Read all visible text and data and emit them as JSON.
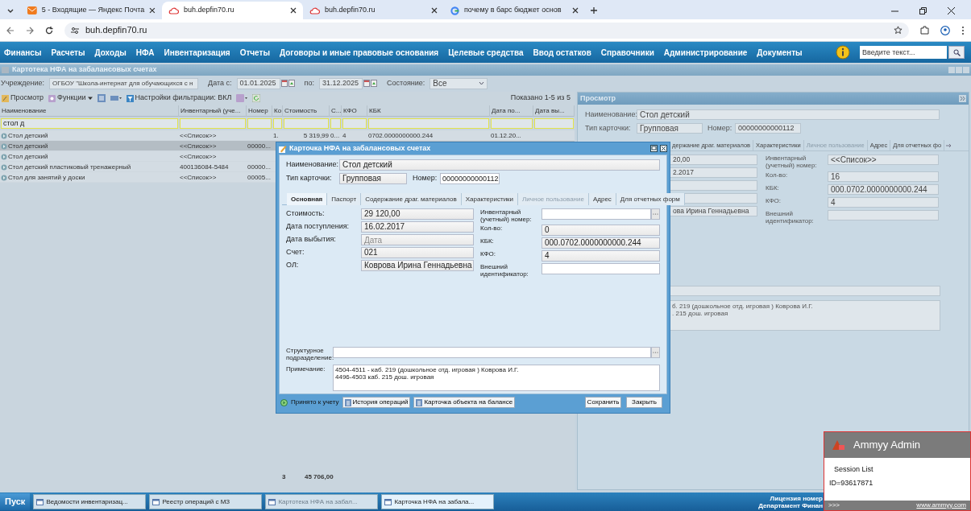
{
  "browser": {
    "tabs": [
      {
        "title": "5 - Входящие — Яндекс Почта",
        "kind": "mail",
        "selected": false
      },
      {
        "title": "buh.depfin70.ru",
        "kind": "cloud",
        "selected": true
      },
      {
        "title": "buh.depfin70.ru",
        "kind": "cloud",
        "selected": false
      },
      {
        "title": "почему в барс бюджет основ",
        "kind": "google",
        "selected": false
      }
    ],
    "url": "buh.depfin70.ru"
  },
  "menu": {
    "items": [
      "Финансы",
      "Расчеты",
      "Доходы",
      "НФА",
      "Инвентаризация",
      "Отчеты",
      "Договоры и иные правовые основания",
      "Целевые средства",
      "Ввод остатков",
      "Справочники",
      "Администрирование",
      "Документы"
    ],
    "search": {
      "placeholder": "Введите текст..."
    }
  },
  "section_title": "Картотека НФА на забалансовых счетах",
  "filters": [
    {
      "label": "Учреждение:",
      "value": "ОГБОУ \"Школа-интернат для обучающихся с н",
      "kind": "text"
    },
    {
      "label": "Дата с:",
      "value": "01.01.2025",
      "kind": "date"
    },
    {
      "label": "по:",
      "value": "31.12.2025",
      "kind": "date"
    },
    {
      "label": "Состояние:",
      "value": "Все",
      "kind": "select"
    }
  ],
  "grid": {
    "toolbar": {
      "view": "Просмотр",
      "functions": "Функции",
      "filter_settings": "Настройки фильтрации: ВКЛ",
      "shown": "Показано 1-5 из 5"
    },
    "columns": [
      "Наименование",
      "Инвентарный (уче...",
      "Номер",
      "Ко",
      "Стоимость",
      "С...",
      "КФО",
      "КБК",
      "Дата по...",
      "Дата вы..."
    ],
    "filter_value": "стол д",
    "rows": [
      {
        "cells": [
          "Стол детский",
          "<<Список>>",
          "",
          "1.",
          "5 319,99",
          "0...",
          "4",
          "0702.0000000000.244",
          "01.12.20..."
        ],
        "selected": false
      },
      {
        "cells": [
          "Стол детский",
          "<<Список>>",
          "00000..."
        ],
        "selected": true
      },
      {
        "cells": [
          "Стол детский",
          "<<Список>>"
        ],
        "selected": false
      },
      {
        "cells": [
          "Стол детский пластиковый тренажерный",
          "400136084-5484",
          "00000..."
        ],
        "selected": false
      },
      {
        "cells": [
          "Стол для занятий у доски",
          "<<Список>>",
          "00005..."
        ],
        "selected": false
      }
    ],
    "footer": {
      "count": "3",
      "total": "45 706,00"
    }
  },
  "view_panel": {
    "title": "Просмотр",
    "name_label": "Наименование:",
    "name_value": "Стол детский",
    "type_label": "Тип карточки:",
    "type_value": "Групповая",
    "number_label": "Номер:",
    "number_value": "00000000000112",
    "tabs": [
      {
        "label": "держание драг. материалов",
        "disabled": false
      },
      {
        "label": "Характеристики",
        "disabled": false
      },
      {
        "label": "Личное пользование",
        "disabled": true
      },
      {
        "label": "Адрес",
        "disabled": false
      },
      {
        "label": "Для отчетных фо",
        "disabled": false
      }
    ],
    "left_fields": [
      {
        "kind": "value",
        "value": "20,00"
      },
      {
        "kind": "value",
        "value": "2.2017"
      },
      {
        "kind": "empty"
      },
      {
        "kind": "empty"
      },
      {
        "kind": "value",
        "value": "ова Ирина Геннадьевна"
      }
    ],
    "right_fields": [
      {
        "label": "Инвентарный (учетный) номер:",
        "value": "<<Список>>"
      },
      {
        "label": "Кол-во:",
        "value": "16"
      },
      {
        "label": "КБК:",
        "value": "000.0702.0000000000.244"
      },
      {
        "label": "КФО:",
        "value": "4"
      },
      {
        "label": "Внешний идентификатор:"
      }
    ],
    "note_lines": [
      "б. 219 (дошкольное отд. игровая ) Коврова И.Г.",
      ". 215 дош. игровая"
    ]
  },
  "dialog": {
    "title": "Карточка НФА на забалансовых счетах",
    "name_label": "Наименование:",
    "name_value": "Стол детский",
    "type_label": "Тип карточки:",
    "type_value": "Групповая",
    "number_label": "Номер:",
    "number_value": "00000000000112",
    "tabs": [
      {
        "label": "Основная",
        "selected": true,
        "disabled": false
      },
      {
        "label": "Паспорт",
        "selected": false,
        "disabled": false
      },
      {
        "label": "Содержание драг. материалов",
        "selected": false,
        "disabled": false
      },
      {
        "label": "Характеристики",
        "selected": false,
        "disabled": false
      },
      {
        "label": "Личное пользование",
        "selected": false,
        "disabled": true
      },
      {
        "label": "Адрес",
        "selected": false,
        "disabled": false
      },
      {
        "label": "Для отчетных форм",
        "selected": false,
        "disabled": false
      }
    ],
    "left_fields": [
      {
        "label": "Стоимость:",
        "value": "29 120,00",
        "disabled": false
      },
      {
        "label": "Дата поступления:",
        "value": "16.02.2017",
        "disabled": false
      },
      {
        "label": "Дата выбытия:",
        "placeholder": "Дата",
        "disabled": true
      },
      {
        "label": "Счет:",
        "value": "021",
        "disabled": false
      },
      {
        "label": "ОЛ:",
        "value": "Коврова Ирина Геннадьевна",
        "disabled": false
      }
    ],
    "right_fields": [
      {
        "label": "Инвентарный (учетный) номер:",
        "picker": true
      },
      {
        "label": "Кол-во:",
        "value": "0",
        "picker": false
      },
      {
        "label": "КБК:",
        "value": "000.0702.0000000000.244",
        "picker": false
      },
      {
        "label": "КФО:",
        "value": "4",
        "picker": false
      },
      {
        "label": "Внешний идентификатор:",
        "picker": false
      }
    ],
    "division_label": "Структурное подразделение:",
    "note_label": "Примечание:",
    "note_lines": [
      "4504-4511 - каб. 219 (дошкольное отд. игровая ) Коврова И.Г.",
      "4496-4503 каб. 215 дош. игровая"
    ],
    "status": "Принято к учету",
    "history_button": "История операций",
    "balance_button": "Карточка объекта на балансе",
    "save_button": "Сохранить",
    "close_button": "Закрыть"
  },
  "taskbar": {
    "start": "Пуск",
    "items": [
      {
        "title": "Ведомости инвентаризац...",
        "selected": false,
        "dimmed": false
      },
      {
        "title": "Реестр операций с МЗ",
        "selected": false,
        "dimmed": false
      },
      {
        "title": "Картотека НФА на забал...",
        "selected": false,
        "dimmed": true
      },
      {
        "title": "Карточка НФА на забала...",
        "selected": true,
        "dimmed": false
      }
    ],
    "license_lines": [
      "Лицензия номер",
      "Департамент Финан"
    ]
  },
  "ammyy": {
    "title": "Ammyy Admin",
    "session": "Session List",
    "id": "ID=93617871",
    "more": ">>>",
    "link": "www.ammyy.com"
  }
}
